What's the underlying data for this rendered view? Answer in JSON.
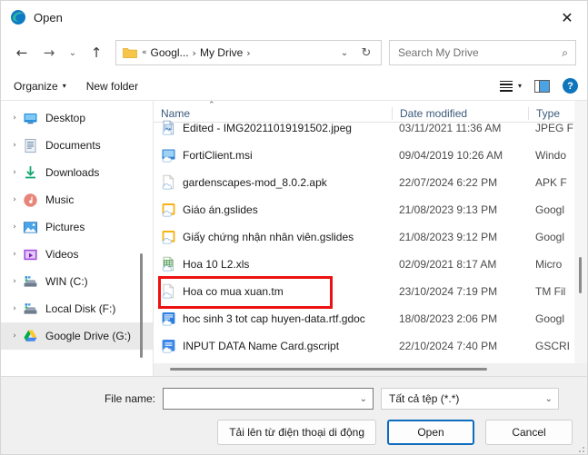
{
  "window": {
    "title": "Open",
    "app_icon": "edge-logo-icon",
    "close_label": "✕"
  },
  "nav": {
    "back": "←",
    "forward": "→",
    "recent": "⌄",
    "up": "↑"
  },
  "address": {
    "folder_icon": "folder-icon",
    "overflow": "«",
    "crumbs": [
      "Googl...",
      "My Drive"
    ],
    "separator": "›",
    "dropdown": "⌄",
    "refresh": "↻"
  },
  "search": {
    "placeholder": "Search My Drive",
    "icon": "⌕"
  },
  "commandbar": {
    "organize": "Organize",
    "organize_caret": "▾",
    "new_folder": "New folder",
    "view_caret": "▾",
    "help": "?"
  },
  "sidebar": {
    "items": [
      {
        "label": "Desktop",
        "icon": "desktop-icon",
        "chevron": "›",
        "selected": false
      },
      {
        "label": "Documents",
        "icon": "documents-icon",
        "chevron": "›",
        "selected": false
      },
      {
        "label": "Downloads",
        "icon": "downloads-icon",
        "chevron": "›",
        "selected": false
      },
      {
        "label": "Music",
        "icon": "music-icon",
        "chevron": "›",
        "selected": false
      },
      {
        "label": "Pictures",
        "icon": "pictures-icon",
        "chevron": "›",
        "selected": false
      },
      {
        "label": "Videos",
        "icon": "videos-icon",
        "chevron": "›",
        "selected": false
      },
      {
        "label": "WIN (C:)",
        "icon": "hard-drive-icon",
        "chevron": "›",
        "selected": false
      },
      {
        "label": "Local Disk (F:)",
        "icon": "hard-drive-icon",
        "chevron": "›",
        "selected": false
      },
      {
        "label": "Google Drive (G:)",
        "icon": "google-drive-icon",
        "chevron": "›",
        "selected": true
      }
    ]
  },
  "filelist": {
    "sort_indicator": "⌃",
    "columns": [
      "Name",
      "Date modified",
      "Type"
    ],
    "rows": [
      {
        "name": "Edited - IMG20211019191502.jpeg",
        "date": "03/11/2021 11:36 AM",
        "type": "JPEG F",
        "icon": "image-file-icon",
        "highlighted": false
      },
      {
        "name": "FortiClient.msi",
        "date": "09/04/2019 10:26 AM",
        "type": "Windo",
        "icon": "msi-file-icon",
        "highlighted": false
      },
      {
        "name": "gardenscapes-mod_8.0.2.apk",
        "date": "22/07/2024 6:22 PM",
        "type": "APK F",
        "icon": "generic-file-icon",
        "highlighted": false
      },
      {
        "name": "Giáo án.gslides",
        "date": "21/08/2023 9:13 PM",
        "type": "Googl",
        "icon": "gslides-file-icon",
        "highlighted": false
      },
      {
        "name": "Giấy chứng nhận nhân viên.gslides",
        "date": "21/08/2023 9:12 PM",
        "type": "Googl",
        "icon": "gslides-file-icon",
        "highlighted": false
      },
      {
        "name": "Hoa 10 L2.xls",
        "date": "02/09/2021 8:17 AM",
        "type": "Micro",
        "icon": "excel-file-icon",
        "highlighted": false
      },
      {
        "name": "Hoa co mua xuan.tm",
        "date": "23/10/2024 7:19 PM",
        "type": "TM Fil",
        "icon": "generic-file-icon",
        "highlighted": true
      },
      {
        "name": "hoc sinh 3 tot cap huyen-data.rtf.gdoc",
        "date": "18/08/2023 2:06 PM",
        "type": "Googl",
        "icon": "gdoc-file-icon",
        "highlighted": false
      },
      {
        "name": "INPUT DATA Name Card.gscript",
        "date": "22/10/2024 7:40 PM",
        "type": "GSCRI",
        "icon": "gscript-file-icon",
        "highlighted": false
      }
    ]
  },
  "footer": {
    "filename_label": "File name:",
    "filename_value": "",
    "filename_placeholder": "",
    "filter_value": "Tất cả tệp (*.*)",
    "chevron": "⌄",
    "upload_button": "Tải lên từ điện thoại di động",
    "open_button": "Open",
    "cancel_button": "Cancel"
  },
  "colors": {
    "highlight": "#ee1111",
    "accent": "#0f6cbd",
    "column_header": "#3b5a7a"
  }
}
